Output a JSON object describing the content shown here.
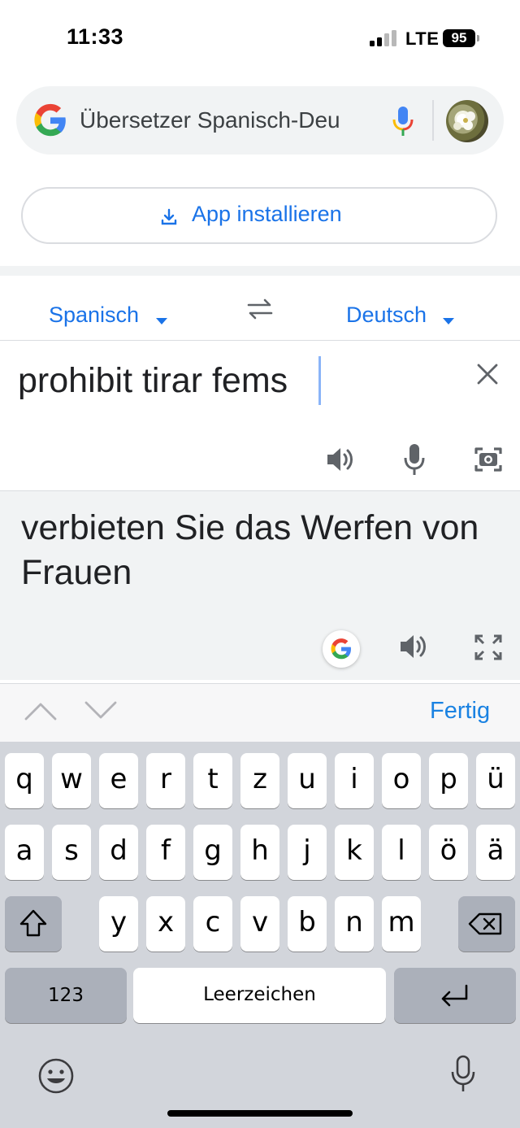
{
  "status_bar": {
    "time": "11:33",
    "network": "LTE",
    "battery": "95"
  },
  "search": {
    "query": "Übersetzer Spanisch-Deu"
  },
  "install": {
    "label": "App installieren"
  },
  "translator": {
    "source_lang": "Spanisch",
    "target_lang": "Deutsch",
    "input_text": "prohibit tirar fems",
    "output_text": "verbieten Sie das Werfen von Frauen"
  },
  "keyboard_toolbar": {
    "done_label": "Fertig"
  },
  "keyboard": {
    "row1": [
      "q",
      "w",
      "e",
      "r",
      "t",
      "z",
      "u",
      "i",
      "o",
      "p",
      "ü"
    ],
    "row2": [
      "a",
      "s",
      "d",
      "f",
      "g",
      "h",
      "j",
      "k",
      "l",
      "ö",
      "ä"
    ],
    "row3": [
      "y",
      "x",
      "c",
      "v",
      "b",
      "n",
      "m"
    ],
    "numbers_label": "123",
    "space_label": "Leerzeichen"
  },
  "colors": {
    "accent": "#1a73e8",
    "keyboard_bg": "#d2d5db",
    "panel_bg": "#f1f3f4"
  },
  "icons": [
    "google-logo",
    "microphone",
    "swap",
    "close",
    "speaker",
    "camera",
    "expand",
    "shift",
    "backspace",
    "return",
    "emoji"
  ]
}
